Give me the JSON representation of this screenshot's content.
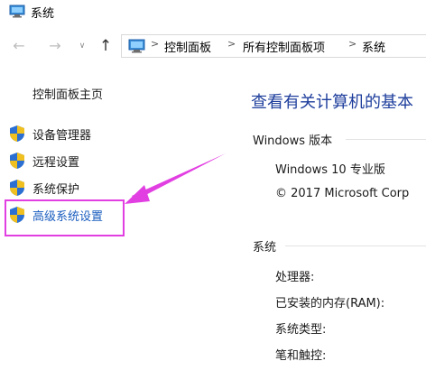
{
  "window": {
    "title": "系统",
    "app_icon": "control-panel-icon"
  },
  "navigation": {
    "back_icon": "back-arrow-icon",
    "forward_icon": "forward-arrow-icon",
    "recent_icon": "chevron-down-icon",
    "up_icon": "up-arrow-icon",
    "back_glyph": "←",
    "forward_glyph": "→",
    "recent_glyph": "∨",
    "up_glyph": "↑",
    "breadcrumb_separator": ">",
    "breadcrumbs": [
      "控制面板",
      "所有控制面板项",
      "系统"
    ]
  },
  "sidebar": {
    "home_link": "控制面板主页",
    "items": [
      {
        "label": "设备管理器",
        "icon": "shield-icon"
      },
      {
        "label": "远程设置",
        "icon": "shield-icon"
      },
      {
        "label": "系统保护",
        "icon": "shield-icon"
      },
      {
        "label": "高级系统设置",
        "icon": "shield-icon"
      }
    ]
  },
  "main": {
    "title": "查看有关计算机的基本",
    "edition_section": {
      "header": "Windows 版本",
      "edition_name": "Windows 10 专业版",
      "copyright": "© 2017 Microsoft Corp"
    },
    "system_section": {
      "header": "系统",
      "specs": [
        {
          "label": "处理器:"
        },
        {
          "label": "已安装的内存(RAM):"
        },
        {
          "label": "系统类型:"
        },
        {
          "label": "笔和触控:"
        }
      ]
    }
  },
  "annotation": {
    "color": "#e23fe2"
  },
  "colors": {
    "link": "#1a5dbf",
    "title": "#1e3e9c",
    "shield_blue": "#2a6fd1",
    "shield_yellow": "#f0c020"
  }
}
